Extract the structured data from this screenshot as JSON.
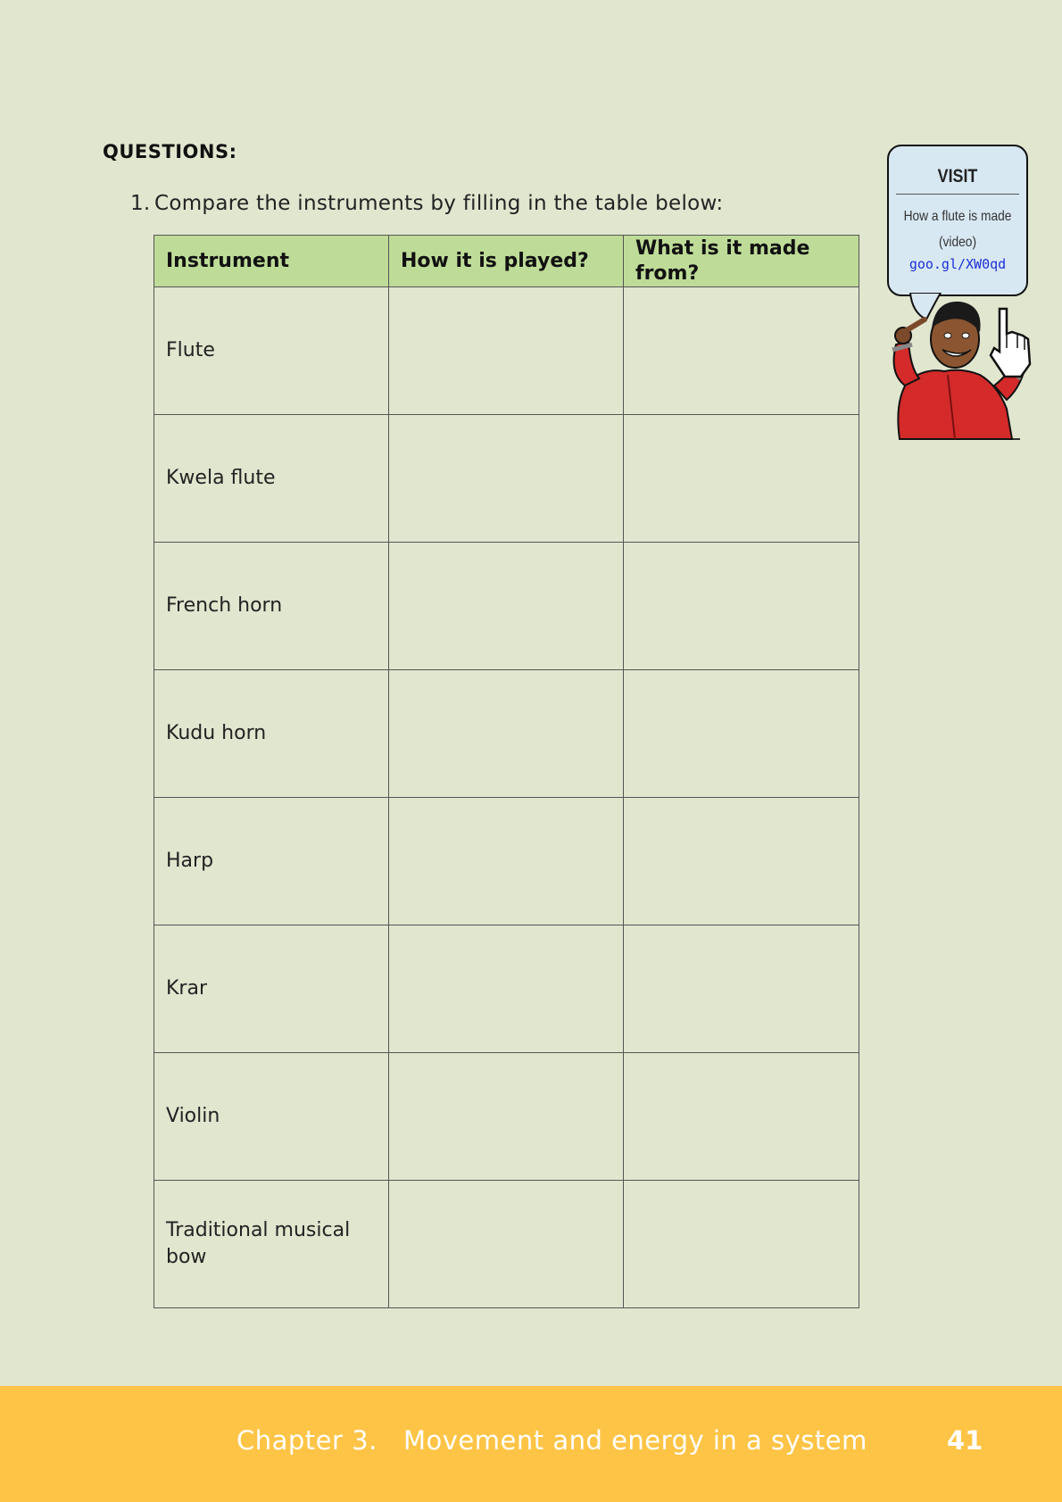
{
  "questions": {
    "heading": "QUESTIONS:",
    "items": [
      {
        "number": "1.",
        "text": "Compare the instruments by filling in the table below:"
      }
    ]
  },
  "table": {
    "headers": [
      "Instrument",
      "How it is played?",
      "What is it made from?"
    ],
    "rows": [
      [
        "Flute",
        "",
        ""
      ],
      [
        "Kwela flute",
        "",
        ""
      ],
      [
        "French horn",
        "",
        ""
      ],
      [
        "Kudu horn",
        "",
        ""
      ],
      [
        "Harp",
        "",
        ""
      ],
      [
        "Krar",
        "",
        ""
      ],
      [
        "Violin",
        "",
        ""
      ],
      [
        "Traditional musical bow",
        "",
        ""
      ]
    ]
  },
  "visit_box": {
    "title": "VISIT",
    "description_line1": "How a flute is made",
    "description_line2": "(video)",
    "link": "goo.gl/XW0qd",
    "icons": [
      "character-illustration",
      "pointer-hand-icon"
    ]
  },
  "footer": {
    "chapter": "Chapter 3.   Movement and energy in a system",
    "page_number": "41"
  },
  "colors": {
    "page_background": "#e1e6cf",
    "table_header": "#bedc98",
    "visit_box": "#d8e8f3",
    "link": "#1b2fd6",
    "footer": "#fec446"
  }
}
